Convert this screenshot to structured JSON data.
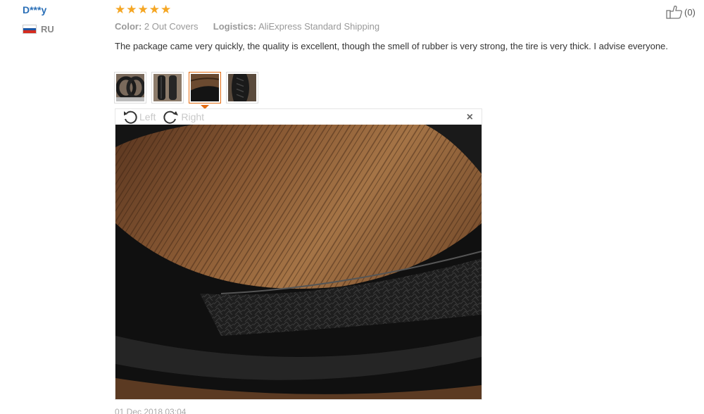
{
  "reviewer": {
    "name": "D***y",
    "country_code": "RU",
    "flag_colors": [
      "#ffffff",
      "#1c57a5",
      "#d52b1e"
    ]
  },
  "rating": {
    "stars": 5,
    "star_glyph": "★",
    "color": "#f5a623"
  },
  "attributes": {
    "color_label": "Color:",
    "color_value": "2 Out Covers",
    "logistics_label": "Logistics:",
    "logistics_value": "AliExpress Standard Shipping"
  },
  "review_text": "The package came very quickly, the quality is excellent, though the smell of rubber is very strong, the tire is very thick. I advise everyone.",
  "helpful": {
    "count_text": "(0)",
    "icon": "thumbs-up-icon"
  },
  "thumbnails": [
    {
      "icon": "tire-photo-1",
      "active": false
    },
    {
      "icon": "tire-photo-2",
      "active": false
    },
    {
      "icon": "tire-photo-3",
      "active": true
    },
    {
      "icon": "tire-photo-4",
      "active": false
    }
  ],
  "viewer": {
    "rotate_left_label": "Left",
    "rotate_right_label": "Right",
    "close_glyph": "×"
  },
  "date": "01 Dec 2018 03:04",
  "colors": {
    "username": "#2a6fb7",
    "accent": "#e36c12"
  }
}
